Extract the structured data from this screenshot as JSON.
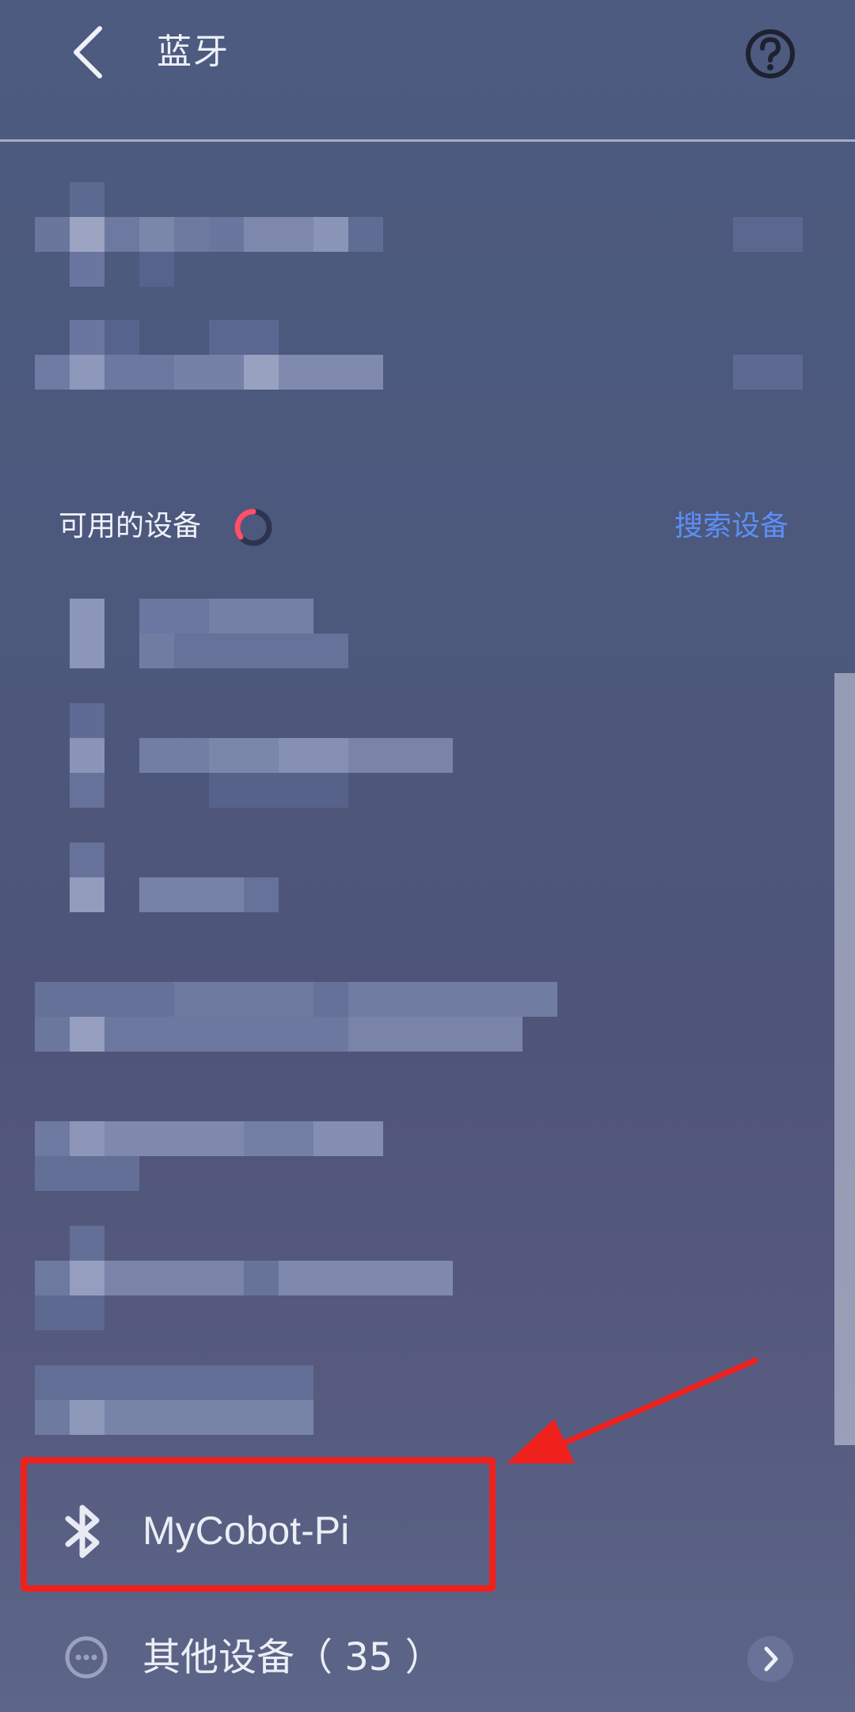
{
  "header": {
    "title": "蓝牙",
    "back_icon": "back-chevron-icon",
    "help_icon": "help-question-icon"
  },
  "available_section": {
    "label": "可用的设备",
    "search_label": "搜索设备",
    "spinner_color": "#ff4f6a",
    "link_color": "#5b8ff5"
  },
  "highlighted_device": {
    "name": "MyCobot-Pi",
    "icon": "bluetooth-icon",
    "highlight_color": "#f0201c"
  },
  "other_devices": {
    "label": "其他设备（ 35 ）",
    "icon": "more-dots-icon"
  }
}
